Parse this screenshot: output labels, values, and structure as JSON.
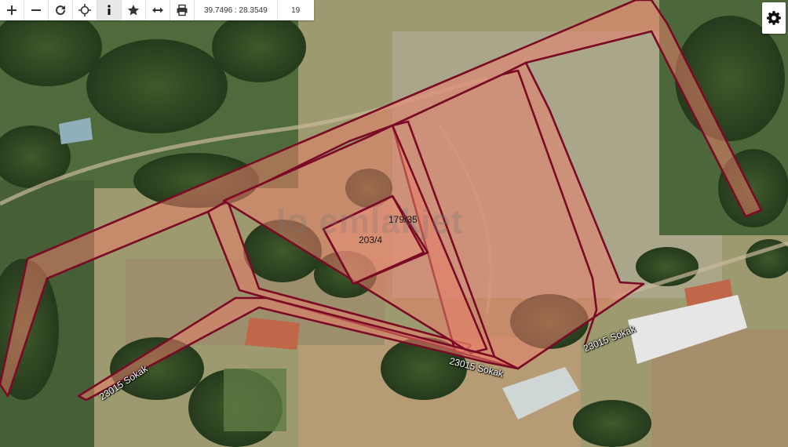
{
  "toolbar": {
    "coordinates": "39.7496 : 28.3549",
    "zoom_level": "19"
  },
  "parcels": {
    "label_a": "179/35",
    "label_b": "203/4"
  },
  "roads": {
    "street_1": "23015 Sokak",
    "street_2": "23015 Sokak",
    "street_3": "23015 Sokak"
  },
  "watermark": "lo emlakjet",
  "colors": {
    "parcel_stroke": "#7a0a25",
    "parcel_fill": "#e8806a"
  }
}
